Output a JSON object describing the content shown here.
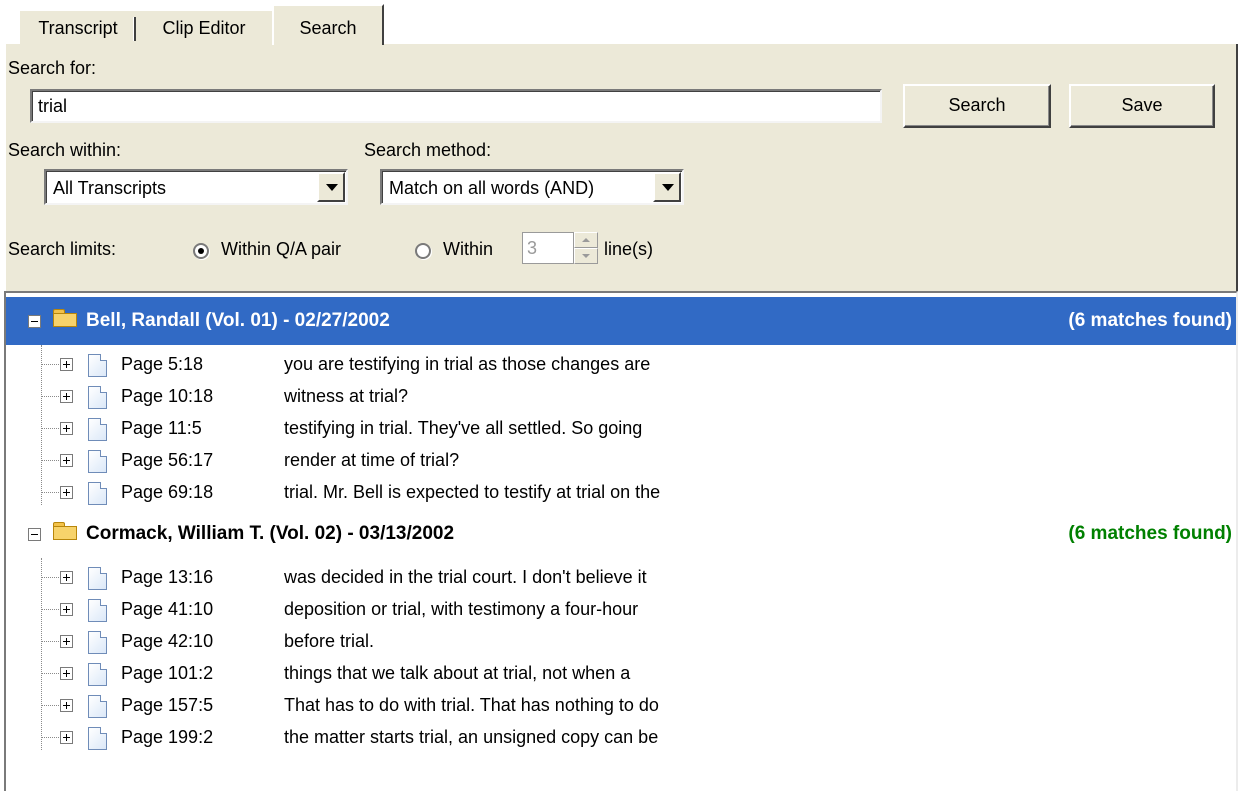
{
  "tabs": [
    "Transcript",
    "Clip Editor",
    "Search"
  ],
  "search": {
    "for_label": "Search for:",
    "query": "trial",
    "search_button": "Search",
    "save_button": "Save",
    "within_label": "Search within:",
    "within_value": "All Transcripts",
    "method_label": "Search method:",
    "method_value": "Match on all words (AND)",
    "limits_label": "Search limits:",
    "limit_option_qa": "Within Q/A pair",
    "limit_option_within": "Within",
    "limit_lines_value": "3",
    "limit_lines_suffix": "line(s)"
  },
  "results": [
    {
      "title": "Bell, Randall (Vol. 01) - 02/27/2002",
      "count": "(6 matches found)",
      "selected": true,
      "items": [
        {
          "page": "Page 5:18",
          "text": "you are testifying in trial as those changes are"
        },
        {
          "page": "Page 10:18",
          "text": "witness at trial?"
        },
        {
          "page": "Page 11:5",
          "text": "testifying in trial.  They've all settled.  So going"
        },
        {
          "page": "Page 56:17",
          "text": "render at time of trial?"
        },
        {
          "page": "Page 69:18",
          "text": "trial.  Mr. Bell is expected to testify at trial on the"
        }
      ]
    },
    {
      "title": "Cormack, William T. (Vol. 02) - 03/13/2002",
      "count": "(6 matches found)",
      "selected": false,
      "items": [
        {
          "page": "Page 13:16",
          "text": "was decided in the trial court.  I don't believe it"
        },
        {
          "page": "Page 41:10",
          "text": "deposition or trial, with testimony a four-hour"
        },
        {
          "page": "Page 42:10",
          "text": "before trial."
        },
        {
          "page": "Page 101:2",
          "text": "things that we talk about at trial, not when a"
        },
        {
          "page": "Page 157:5",
          "text": "That has to do with trial.  That has nothing to do"
        },
        {
          "page": "Page 199:2",
          "text": "the matter starts trial, an unsigned copy can be"
        }
      ]
    }
  ],
  "colors": {
    "selection": "#316ac5",
    "match_count": "#008000",
    "panel": "#ece9d8"
  }
}
